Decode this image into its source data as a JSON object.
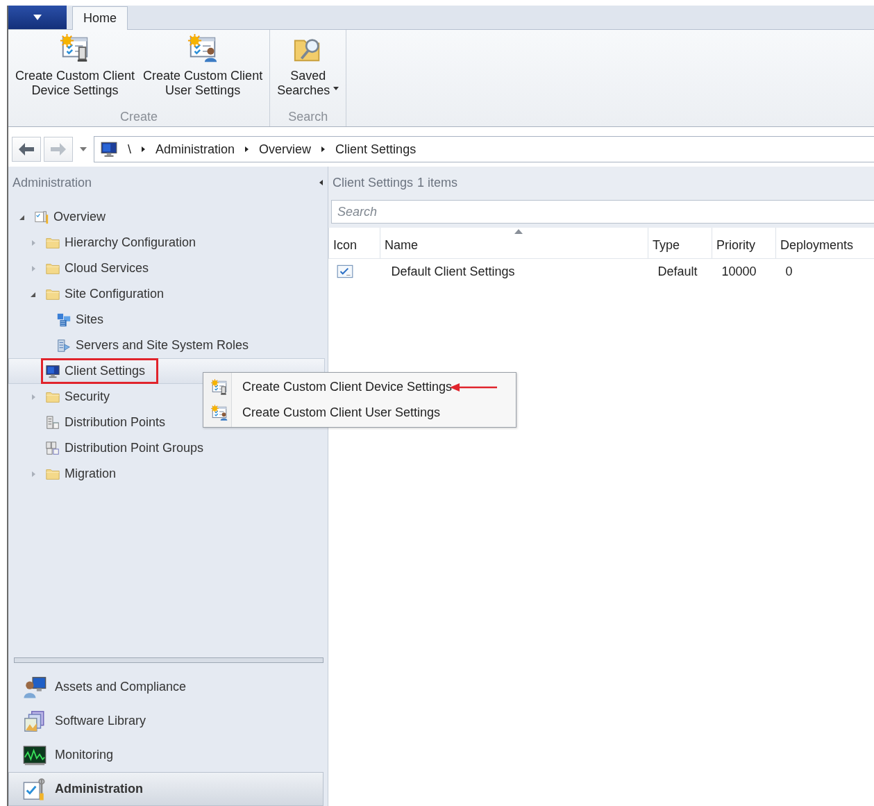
{
  "ribbon": {
    "tabs": [
      {
        "label": "Home",
        "selected": true
      }
    ],
    "groups": [
      {
        "label": "Create",
        "buttons": [
          {
            "kind": "device-settings",
            "label": "Create Custom Client\nDevice Settings",
            "dropdown": false
          },
          {
            "kind": "user-settings",
            "label": "Create Custom Client\nUser Settings",
            "dropdown": false
          }
        ]
      },
      {
        "label": "Search",
        "buttons": [
          {
            "kind": "saved-searches",
            "label": "Saved\nSearches",
            "dropdown": true
          }
        ]
      }
    ]
  },
  "address_bar": {
    "root": "\\",
    "crumbs": [
      "Administration",
      "Overview",
      "Client Settings"
    ]
  },
  "navigation": {
    "title": "Administration",
    "tree": [
      {
        "label": "Overview",
        "kind": "overview",
        "expanded": true,
        "selected": false,
        "highlighted": false,
        "children": [
          {
            "label": "Hierarchy Configuration",
            "kind": "folder",
            "expanded": false,
            "selected": false,
            "highlighted": false
          },
          {
            "label": "Cloud Services",
            "kind": "folder",
            "expanded": false,
            "selected": false,
            "highlighted": false
          },
          {
            "label": "Site Configuration",
            "kind": "folder",
            "expanded": true,
            "selected": false,
            "highlighted": false,
            "children": [
              {
                "label": "Sites",
                "kind": "sites",
                "selected": false,
                "highlighted": false
              },
              {
                "label": "Servers and Site System Roles",
                "kind": "servers",
                "selected": false,
                "highlighted": false
              }
            ]
          },
          {
            "label": "Client Settings",
            "kind": "client",
            "selected": true,
            "highlighted": true
          },
          {
            "label": "Security",
            "kind": "folder",
            "expanded": false,
            "selected": false,
            "highlighted": false
          },
          {
            "label": "Distribution Points",
            "kind": "dp",
            "selected": false,
            "highlighted": false
          },
          {
            "label": "Distribution Point Groups",
            "kind": "dpgroup",
            "selected": false,
            "highlighted": false
          },
          {
            "label": "Migration",
            "kind": "folder",
            "expanded": false,
            "selected": false,
            "highlighted": false
          }
        ]
      }
    ],
    "workspaces": [
      {
        "label": "Assets and Compliance",
        "kind": "assets",
        "selected": false
      },
      {
        "label": "Software Library",
        "kind": "library",
        "selected": false
      },
      {
        "label": "Monitoring",
        "kind": "monitoring",
        "selected": false
      },
      {
        "label": "Administration",
        "kind": "admin",
        "selected": true
      }
    ]
  },
  "results": {
    "title": "Client Settings",
    "count": "1 items",
    "search": {
      "placeholder": "Search"
    },
    "table": {
      "columns": [
        {
          "label": "Icon",
          "sorted": false
        },
        {
          "label": "Name",
          "sorted": true
        },
        {
          "label": "Type",
          "sorted": false
        },
        {
          "label": "Priority",
          "sorted": false
        },
        {
          "label": "Deployments",
          "sorted": false
        }
      ],
      "rows": [
        {
          "kind": "settings",
          "cells": [
            "",
            "Default Client Settings",
            "Default",
            "10000",
            "0"
          ]
        }
      ]
    }
  },
  "context_menu": {
    "items": [
      {
        "kind": "device-settings",
        "label": "Create Custom Client Device Settings",
        "marked": true
      },
      {
        "kind": "user-settings",
        "label": "Create Custom Client User Settings",
        "marked": false
      }
    ]
  }
}
